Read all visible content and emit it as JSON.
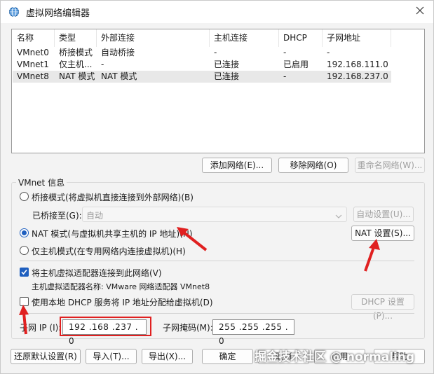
{
  "window": {
    "title": "虚拟网络编辑器"
  },
  "list": {
    "columns": [
      "名称",
      "类型",
      "外部连接",
      "主机连接",
      "DHCP",
      "子网地址"
    ],
    "rows": [
      [
        "VMnet0",
        "桥接模式",
        "自动桥接",
        "-",
        "-",
        "-"
      ],
      [
        "VMnet1",
        "仅主机...",
        "-",
        "已连接",
        "已启用",
        "192.168.111.0"
      ],
      [
        "VMnet8",
        "NAT 模式",
        "NAT 模式",
        "已连接",
        "-",
        "192.168.237.0"
      ]
    ],
    "selected_index": 2
  },
  "list_buttons": {
    "add": "添加网络(E)...",
    "remove": "移除网络(O)",
    "rename": "重命名网络(W)..."
  },
  "vmnet_info": {
    "group_label": "VMnet 信息",
    "bridge_radio": "桥接模式(将虚拟机直接连接到外部网络)(B)",
    "bridged_to_label": "已桥接至(G):",
    "bridged_to_value": "自动",
    "auto_settings": "自动设置(U)...",
    "nat_radio": "NAT 模式(与虚拟机共享主机的 IP 地址)(N)",
    "nat_settings": "NAT 设置(S)...",
    "hostonly_radio": "仅主机模式(在专用网络内连接虚拟机)(H)",
    "connect_adapter_check": "将主机虚拟适配器连接到此网络(V)",
    "adapter_name": "主机虚拟适配器名称: VMware 网络适配器 VMnet8",
    "dhcp_check": "使用本地 DHCP 服务将 IP 地址分配给虚拟机(D)",
    "dhcp_settings": "DHCP 设置(P)...",
    "subnet_ip_label": "子网 IP (I):",
    "subnet_ip_value": "192 .168 .237 . 0",
    "subnet_mask_label": "子网掩码(M):",
    "subnet_mask_value": "255 .255 .255 . 0",
    "selected_mode": "nat",
    "connect_adapter_checked": true,
    "dhcp_checked": false
  },
  "footer": {
    "restore": "还原默认设置(R)",
    "import": "导入(T)...",
    "export": "导出(X)...",
    "ok": "确定",
    "cancel": "取消",
    "apply": "应用",
    "help": "帮助"
  },
  "watermark": "掘金技术社区 @ normaling",
  "colors": {
    "accent": "#1f5fbf",
    "annotation": "#e02020"
  }
}
